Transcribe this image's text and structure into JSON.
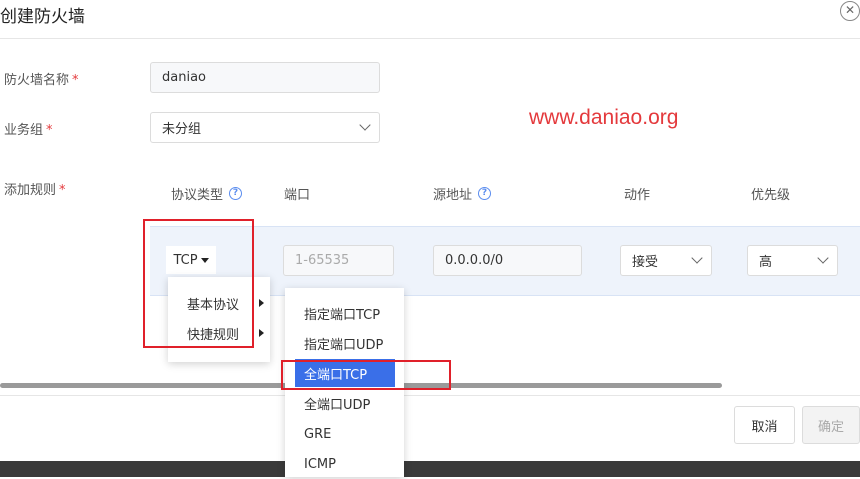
{
  "dialog": {
    "title": "创建防火墙",
    "close_icon": "close-circle-icon"
  },
  "form": {
    "name_label": "防火墙名称",
    "name_value": "daniao",
    "group_label": "业务组",
    "group_value": "未分组",
    "rules_label": "添加规则",
    "required_mark": "*"
  },
  "rules_table": {
    "columns": [
      "协议类型",
      "端口",
      "源地址",
      "动作",
      "优先级"
    ],
    "row": {
      "protocol": "TCP",
      "port_placeholder": "1-65535",
      "source": "0.0.0.0/0",
      "action": "接受",
      "priority": "高"
    }
  },
  "protocol_menu": {
    "items": [
      "基本协议",
      "快捷规则"
    ]
  },
  "quick_rules_menu": {
    "items": [
      "指定端口TCP",
      "指定端口UDP",
      "全端口TCP",
      "全端口UDP",
      "GRE",
      "ICMP"
    ],
    "selected": "全端口TCP"
  },
  "footer": {
    "cancel_label": "取消",
    "confirm_label": "确定"
  },
  "watermark": "www.daniao.org",
  "colors": {
    "accent": "#3a6fe8",
    "highlight_box": "#e0202a",
    "required": "#e4393c"
  }
}
